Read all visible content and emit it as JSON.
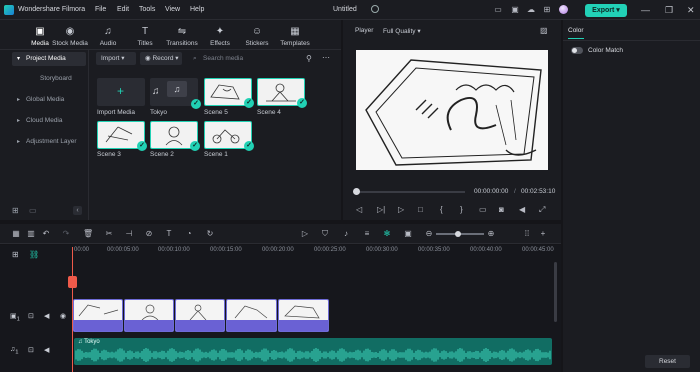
{
  "app": {
    "title": "Wondershare Filmora",
    "document_title": "Untitled",
    "export_label": "Export"
  },
  "menu": [
    "File",
    "Edit",
    "Tools",
    "View",
    "Help"
  ],
  "tabs": [
    {
      "label": "Media",
      "icon": "media-icon"
    },
    {
      "label": "Stock Media",
      "icon": "stock-media-icon"
    },
    {
      "label": "Audio",
      "icon": "audio-icon"
    },
    {
      "label": "Titles",
      "icon": "titles-icon"
    },
    {
      "label": "Transitions",
      "icon": "transitions-icon"
    },
    {
      "label": "Effects",
      "icon": "effects-icon"
    },
    {
      "label": "Stickers",
      "icon": "stickers-icon"
    },
    {
      "label": "Templates",
      "icon": "templates-icon"
    }
  ],
  "sidebar": {
    "items": [
      {
        "label": "Project Media"
      },
      {
        "label": "Storyboard"
      },
      {
        "label": "Global Media"
      },
      {
        "label": "Cloud Media"
      },
      {
        "label": "Adjustment Layer"
      }
    ]
  },
  "media_toolbar": {
    "import_label": "Import",
    "record_label": "Record",
    "search_placeholder": "Search media"
  },
  "media_items": [
    {
      "label": "Import Media"
    },
    {
      "label": "Tokyo"
    },
    {
      "label": "Scene 5"
    },
    {
      "label": "Scene 4"
    },
    {
      "label": "Scene 3"
    },
    {
      "label": "Scene 2"
    },
    {
      "label": "Scene 1"
    }
  ],
  "player": {
    "label": "Player",
    "quality": "Full Quality",
    "current_time": "00:00:00:00",
    "separator": "/",
    "total_time": "00:02:53:10"
  },
  "right_panel": {
    "tab": "Color",
    "color_match_label": "Color Match",
    "reset_label": "Reset"
  },
  "timeline": {
    "ruler": [
      "00:00",
      "00:00:05:00",
      "00:00:10:00",
      "00:00:15:00",
      "00:00:20:00",
      "00:00:25:00",
      "00:00:30:00",
      "00:00:35:00",
      "00:00:40:00",
      "00:00:45:00"
    ],
    "audio_track_label": "Tokyo",
    "video_track_number": "1",
    "audio_track_number": "1"
  },
  "colors": {
    "accent": "#21d1b4",
    "clip_bar": "#6a61d4",
    "audio": "#116d63",
    "playhead": "#ef5a4a"
  }
}
